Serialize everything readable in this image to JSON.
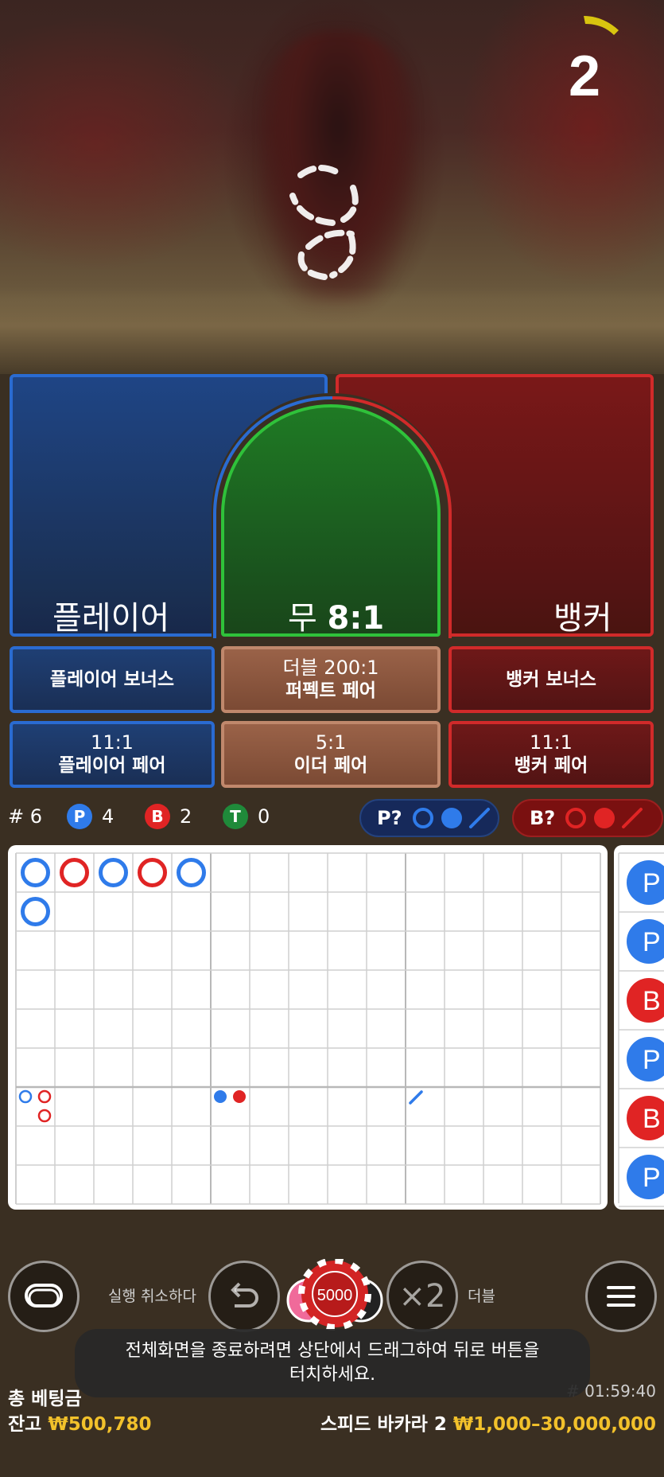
{
  "countdown": "2",
  "spots": {
    "player": "플레이어",
    "tie_name": "무",
    "tie_odds": "8:1",
    "banker": "뱅커"
  },
  "sidebets": {
    "player_bonus": "플레이어 보너스",
    "perfect_pair_odds": "더블 200:1",
    "perfect_pair": "퍼펙트 페어",
    "banker_bonus": "뱅커 보너스",
    "player_pair_odds": "11:1",
    "player_pair": "플레이어 페어",
    "either_pair_odds": "5:1",
    "either_pair": "이더 페어",
    "banker_pair_odds": "11:1",
    "banker_pair": "뱅커 페어"
  },
  "stats": {
    "round_label": "# 6",
    "p_letter": "P",
    "p_count": "4",
    "b_letter": "B",
    "b_count": "2",
    "t_letter": "T",
    "t_count": "0",
    "predict_player": "P?",
    "predict_banker": "B?"
  },
  "road": {
    "bead_results": [
      "P",
      "B",
      "P",
      "B",
      "P",
      "P"
    ],
    "big_road_letters": [
      "P",
      "P",
      "B",
      "P",
      "B",
      "P"
    ]
  },
  "controls": {
    "undo_label": "실행 취소하다",
    "chip_value": "5000",
    "double_text": "×2",
    "double_label": "더블"
  },
  "toast": {
    "line1": "전체화면을 종료하려면 상단에서 드래그하여 뒤로 버튼을",
    "line2": "터치하세요."
  },
  "footer": {
    "total_bet_label": "총 베팅금",
    "balance_label": "잔고",
    "balance_value": "₩500,780",
    "game_name": "스피드 바카라 2",
    "limits": "₩1,000–30,000,000",
    "clock": "# 01:59:40"
  },
  "colors": {
    "player_blue": "#2f7bea",
    "banker_red": "#e02424",
    "tie_green": "#1f8a3a",
    "gold": "#f2c12b"
  }
}
